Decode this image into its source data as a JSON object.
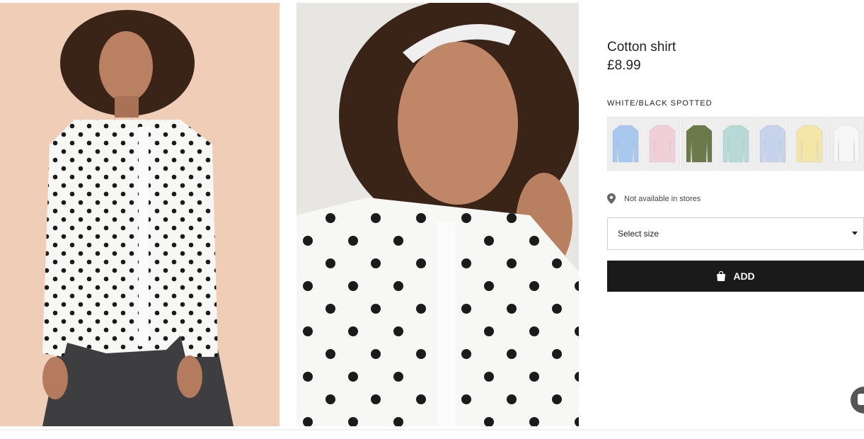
{
  "product": {
    "title": "Cotton shirt",
    "price": "£8.99",
    "selected_color": "WHITE/BLACK SPOTTED"
  },
  "swatches": [
    {
      "name": "light-blue",
      "color": "#a8c8ee"
    },
    {
      "name": "pink-striped",
      "color": "#f0cfd8"
    },
    {
      "name": "khaki-green",
      "color": "#6b7a4a"
    },
    {
      "name": "mint",
      "color": "#b7dad7"
    },
    {
      "name": "blue-striped",
      "color": "#c7d3ea"
    },
    {
      "name": "light-yellow",
      "color": "#f3e6a6"
    },
    {
      "name": "white",
      "color": "#f6f6f6"
    }
  ],
  "store": {
    "text": "Not available in stores",
    "icon": "location-pin-icon"
  },
  "size_select": {
    "value": "Select size",
    "icon": "caret-down-icon"
  },
  "add_button": {
    "label": "ADD",
    "icon": "shopping-bag-icon"
  },
  "colors": {
    "accent": "#1a1a1a",
    "photo1_bg": "#efcdb6",
    "photo2_bg": "#e7e6e2"
  }
}
